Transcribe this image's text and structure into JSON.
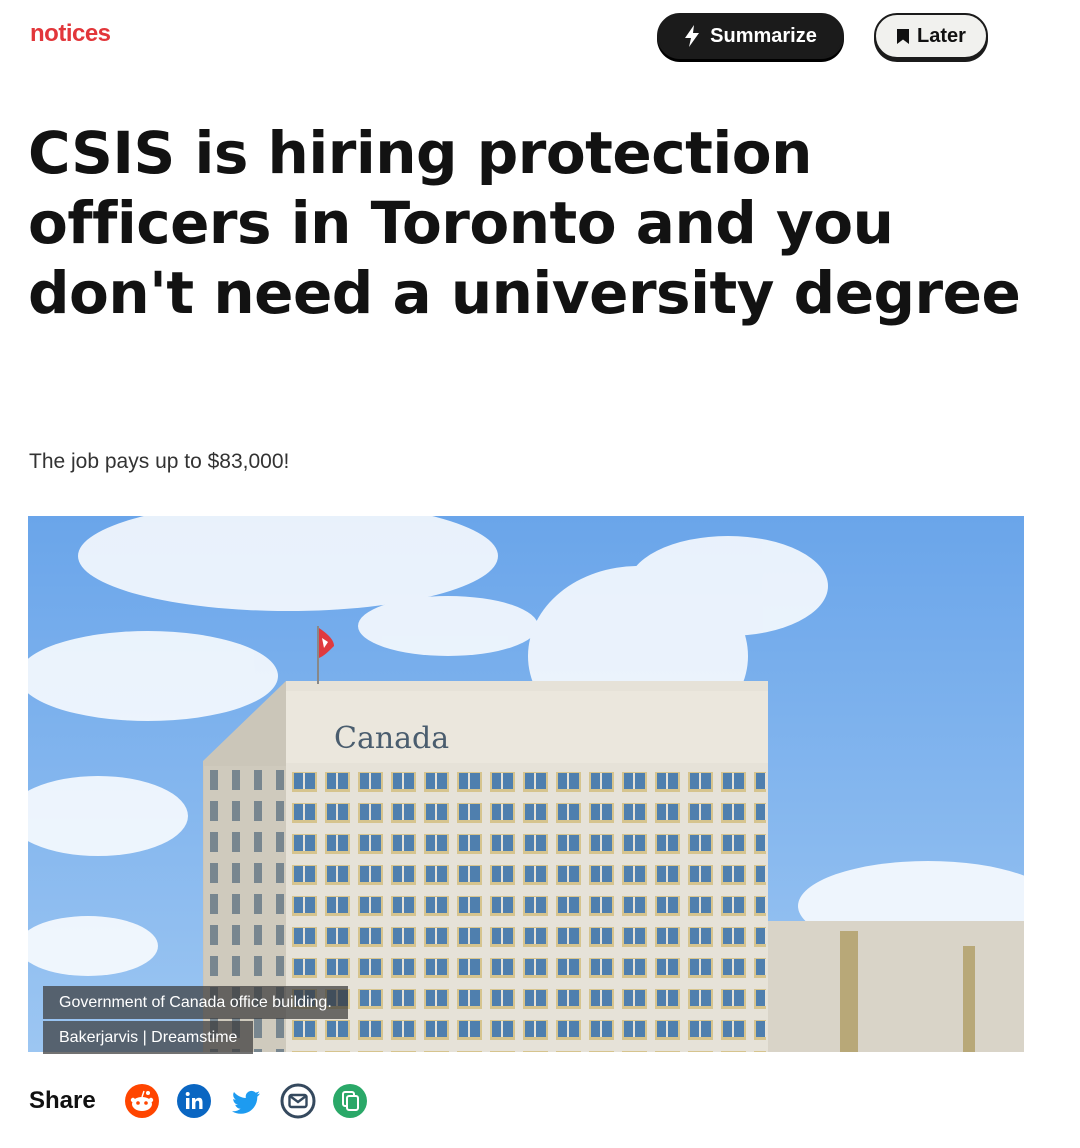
{
  "header": {
    "brand": "notices",
    "summarize_label": "Summarize",
    "later_label": "Later"
  },
  "article": {
    "headline": "CSIS is hiring protection officers in Toronto and you don't need a university degree",
    "dek": "The job pays up to $83,000!",
    "image": {
      "sign_text": "Canada",
      "caption": "Government of Canada office building.",
      "credit": "Bakerjarvis | Dreamstime"
    }
  },
  "share": {
    "label": "Share",
    "icons": [
      "reddit-icon",
      "linkedin-icon",
      "twitter-icon",
      "email-icon",
      "copy-link-icon"
    ]
  },
  "colors": {
    "brand": "#e2363a",
    "button_dark": "#1b1b1b",
    "button_light": "#f1f1ee",
    "reddit": "#ff4500",
    "linkedin": "#0a66c2",
    "twitter": "#1d9bf0",
    "email": "#35495e",
    "copy": "#2aa868",
    "sky": "#7ab0ec"
  }
}
